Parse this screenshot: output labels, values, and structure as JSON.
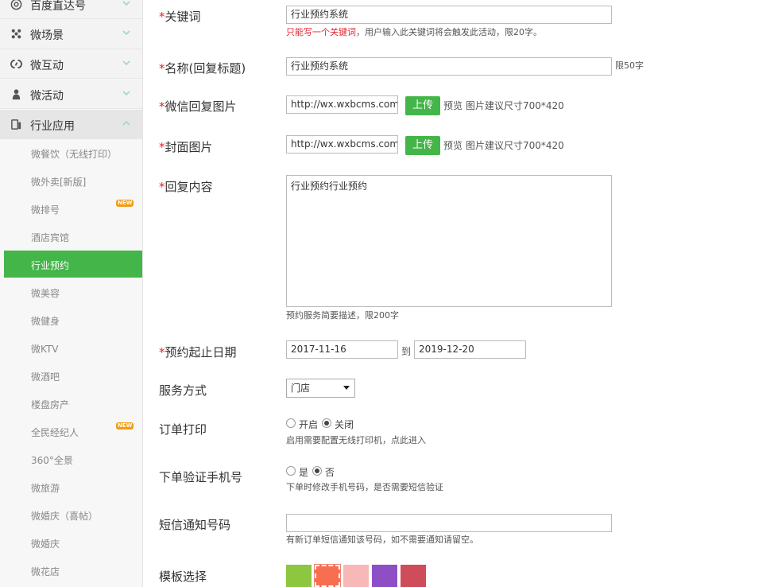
{
  "sidebar": {
    "groups": [
      {
        "label": "百度直达号",
        "icon": "at-icon"
      },
      {
        "label": "微场景",
        "icon": "dots-icon"
      },
      {
        "label": "微互动",
        "icon": "chain-icon"
      },
      {
        "label": "微活动",
        "icon": "person-icon"
      },
      {
        "label": "行业应用",
        "icon": "tablet-icon",
        "expanded": true
      }
    ],
    "items": [
      {
        "label": "微餐饮（无线打印）"
      },
      {
        "label": "微外卖[新版]"
      },
      {
        "label": "微排号",
        "badge": "NEW"
      },
      {
        "label": "酒店宾馆"
      },
      {
        "label": "行业预约",
        "active": true
      },
      {
        "label": "微美容"
      },
      {
        "label": "微健身"
      },
      {
        "label": "微KTV"
      },
      {
        "label": "微酒吧"
      },
      {
        "label": "楼盘房产"
      },
      {
        "label": "全民经纪人",
        "badge": "NEW"
      },
      {
        "label": "360°全景"
      },
      {
        "label": "微旅游"
      },
      {
        "label": "微婚庆（喜帖）"
      },
      {
        "label": "微婚庆"
      },
      {
        "label": "微花店"
      }
    ]
  },
  "form": {
    "required_mark": "*",
    "keyword": {
      "label": "关键词",
      "value": "行业预约系统",
      "hint_red": "只能写一个关键词",
      "hint": "，用户输入此关键词将会触发此活动，限20字。"
    },
    "name": {
      "label": "名称(回复标题)",
      "value": "行业预约系统",
      "hint": "限50字"
    },
    "reply_image": {
      "label": "微信回复图片",
      "value": "http://wx.wxbcms.com/",
      "upload": "上传",
      "preview": "预览",
      "hint": "图片建议尺寸700*420"
    },
    "cover_image": {
      "label": "封面图片",
      "value": "http://wx.wxbcms.com/",
      "upload": "上传",
      "preview": "预览",
      "hint": "图片建议尺寸700*420"
    },
    "reply_content": {
      "label": "回复内容",
      "value": "行业预约行业预约",
      "hint": "预约服务简要描述，限200字"
    },
    "date_range": {
      "label": "预约起止日期",
      "start": "2017-11-16",
      "separator": "到",
      "end": "2019-12-20"
    },
    "service_mode": {
      "label": "服务方式",
      "selected": "门店"
    },
    "order_print": {
      "label": "订单打印",
      "options": [
        "开启",
        "关闭"
      ],
      "selected": "关闭",
      "hint": "启用需要配置无线打印机，点此进入"
    },
    "verify_phone": {
      "label": "下单验证手机号",
      "options": [
        "是",
        "否"
      ],
      "selected": "否",
      "hint": "下单时修改手机号码，是否需要短信验证"
    },
    "sms_number": {
      "label": "短信通知号码",
      "value": "",
      "hint": "有新订单短信通知该号码，如不需要通知请留空。"
    },
    "template": {
      "label": "模板选择",
      "swatches": [
        "#8dc63f",
        "#f86e51",
        "#f9b8b8",
        "#8e4ec6",
        "#cf4d5a"
      ],
      "selected_index": 1
    }
  },
  "colors": {
    "accent": "#44b549",
    "required": "#e5222f"
  }
}
